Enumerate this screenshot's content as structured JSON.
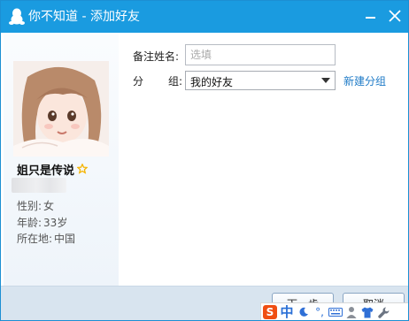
{
  "window": {
    "title": "你不知道 - 添加好友",
    "minimize_label": "minimize",
    "close_label": "close"
  },
  "profile": {
    "nickname": "姐只是传说",
    "gender_label": "性别:",
    "gender": "女",
    "age_label": "年龄:",
    "age": "33岁",
    "location_label": "所在地:",
    "location": "中国"
  },
  "form": {
    "remark_label": "备注姓名:",
    "remark_placeholder": "选填",
    "remark_value": "",
    "group_label_a": "分",
    "group_label_b": "组:",
    "group_selected": "我的好友",
    "new_group_link": "新建分组"
  },
  "buttons": {
    "next": "下一步",
    "cancel": "取消"
  },
  "ime": {
    "logo": "S",
    "mode": "中",
    "punct": "°,",
    "icons": [
      "sogou-logo-icon",
      "moon-icon",
      "punctuation-icon",
      "keyboard-icon",
      "user-icon",
      "shirt-icon",
      "wrench-icon"
    ]
  },
  "colors": {
    "titlebar": "#1a9be0",
    "link": "#1f7bc7",
    "bottom_bar": "#d8e4ef",
    "star": "#f5b400"
  }
}
